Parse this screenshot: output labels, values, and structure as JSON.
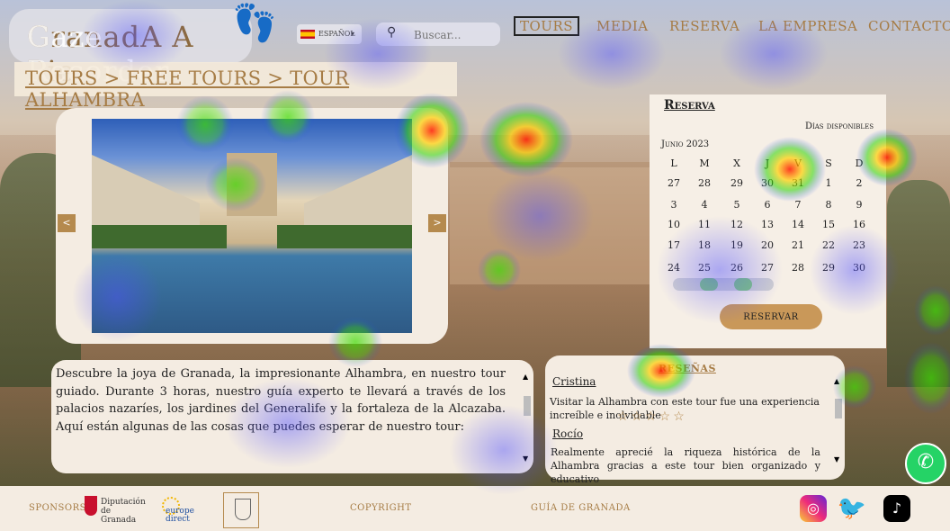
{
  "header": {
    "brand": "GranadA A Pie",
    "brand_overlay": "Gaze Recorder",
    "feet_icon": "footprints-icon",
    "language": "ESPAÑOL",
    "search_placeholder": "Buscar..."
  },
  "nav": {
    "items": [
      {
        "label": "TOURS",
        "active": true
      },
      {
        "label": "MEDIA"
      },
      {
        "label": "RESERVA"
      },
      {
        "label": "LA EMPRESA"
      },
      {
        "label": "CONTACTO"
      }
    ]
  },
  "breadcrumb": "TOURS > FREE TOURS > TOUR ALHAMBRA",
  "gallery": {
    "prev": "<",
    "next": ">"
  },
  "booking": {
    "title": "Reserva",
    "available": "Días disponibles",
    "month": "Junio 2023",
    "weekdays": [
      "L",
      "M",
      "X",
      "J",
      "V",
      "S",
      "D"
    ],
    "weeks": [
      [
        "27",
        "28",
        "29",
        "30",
        "31",
        "1",
        "2"
      ],
      [
        "3",
        "4",
        "5",
        "6",
        "7",
        "8",
        "9"
      ],
      [
        "10",
        "11",
        "12",
        "13",
        "14",
        "15",
        "16"
      ],
      [
        "17",
        "18",
        "19",
        "20",
        "21",
        "22",
        "23"
      ],
      [
        "24",
        "25",
        "26",
        "27",
        "28",
        "29",
        "30"
      ]
    ],
    "button": "RESERVAR"
  },
  "description": "Descubre la joya de Granada, la impresionante Alhambra, en nuestro tour guiado. Durante 3 horas, nuestro guía experto te llevará a través de los palacios nazaríes, los jardines del Generalife y la fortaleza de la Alcazaba. Aquí están algunas de las cosas que puedes esperar de nuestro tour:",
  "reviews": {
    "title": "RESEÑAS",
    "items": [
      {
        "name": "Cristina",
        "text": "Visitar la Alhambra con este tour fue una experiencia increíble e inolvidable",
        "rating": 5
      },
      {
        "name": "Rocío",
        "text": "Realmente aprecié la riqueza histórica de la Alhambra gracias a este tour bien organizado y educativo"
      }
    ]
  },
  "footer": {
    "sponsors": "SPONSORS",
    "sponsor1": "Diputación de Granada",
    "sponsor2": "europe direct",
    "copyright": "COPYRIGHT",
    "guide": "GUÍA DE GRANADA"
  }
}
